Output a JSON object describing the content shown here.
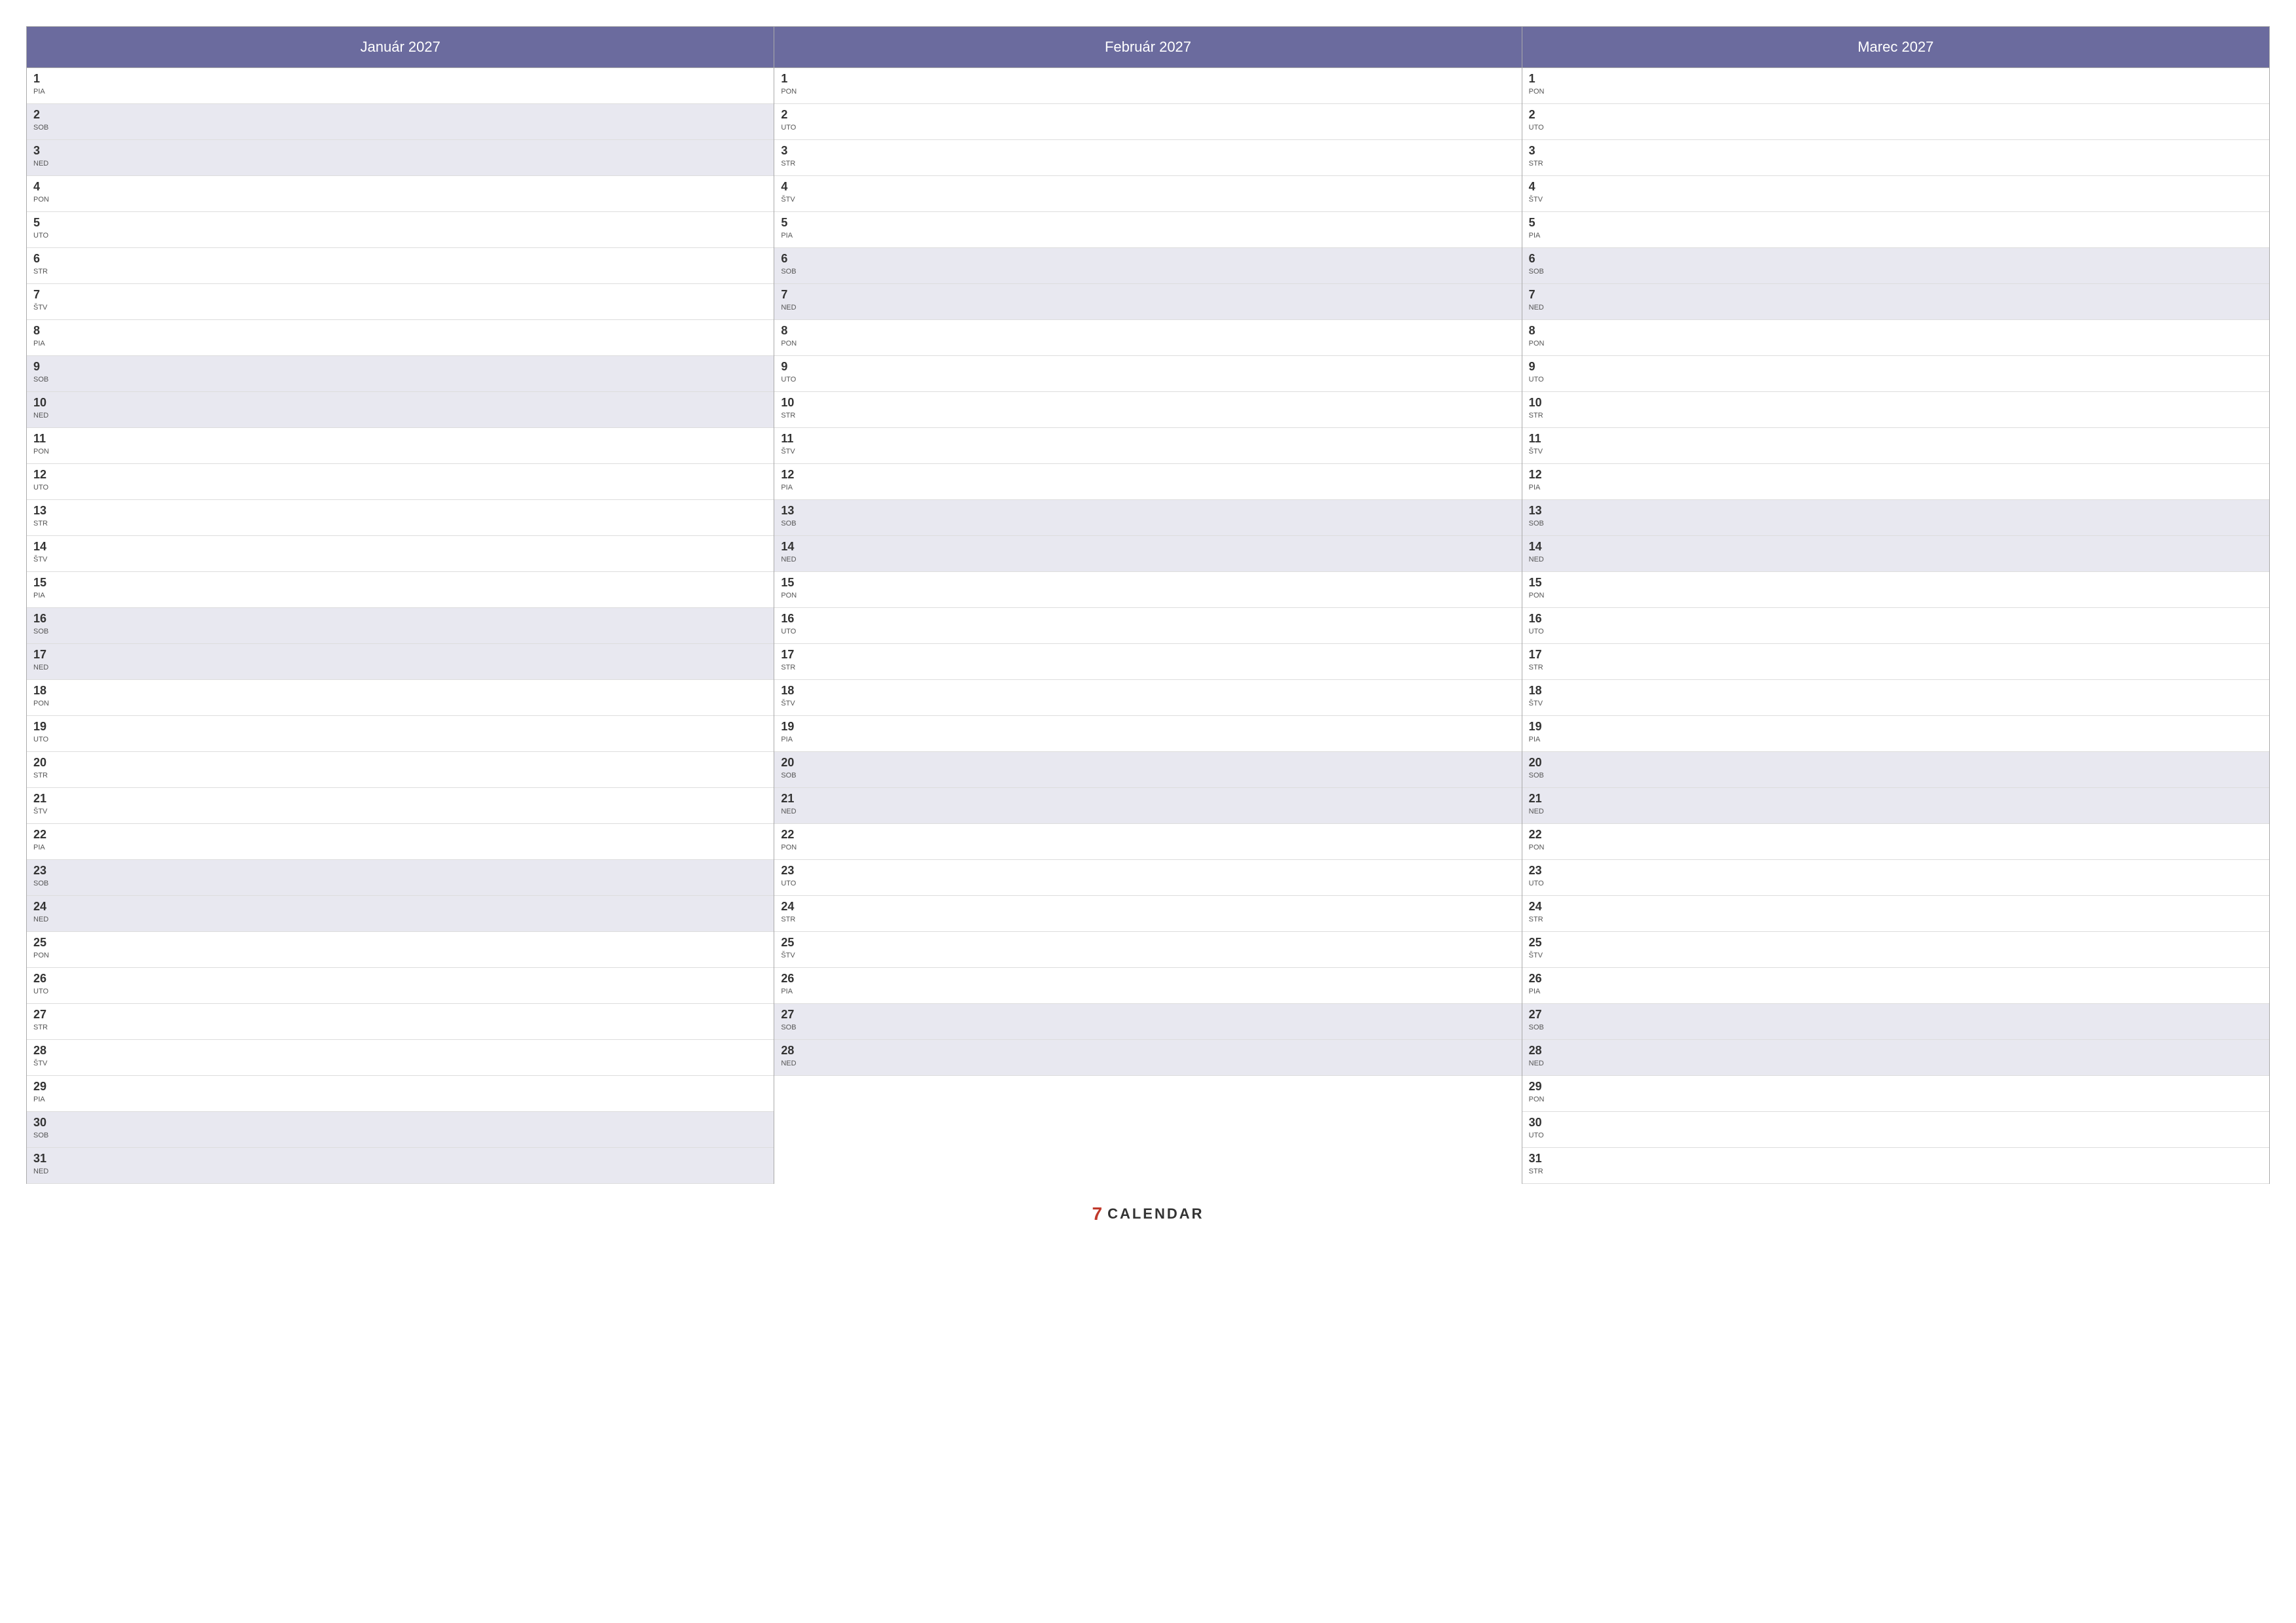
{
  "months": [
    {
      "title": "Január 2027",
      "days": [
        {
          "num": "1",
          "name": "PIA",
          "weekend": false
        },
        {
          "num": "2",
          "name": "SOB",
          "weekend": true
        },
        {
          "num": "3",
          "name": "NED",
          "weekend": true
        },
        {
          "num": "4",
          "name": "PON",
          "weekend": false
        },
        {
          "num": "5",
          "name": "UTO",
          "weekend": false
        },
        {
          "num": "6",
          "name": "STR",
          "weekend": false
        },
        {
          "num": "7",
          "name": "ŠTV",
          "weekend": false
        },
        {
          "num": "8",
          "name": "PIA",
          "weekend": false
        },
        {
          "num": "9",
          "name": "SOB",
          "weekend": true
        },
        {
          "num": "10",
          "name": "NED",
          "weekend": true
        },
        {
          "num": "11",
          "name": "PON",
          "weekend": false
        },
        {
          "num": "12",
          "name": "UTO",
          "weekend": false
        },
        {
          "num": "13",
          "name": "STR",
          "weekend": false
        },
        {
          "num": "14",
          "name": "ŠTV",
          "weekend": false
        },
        {
          "num": "15",
          "name": "PIA",
          "weekend": false
        },
        {
          "num": "16",
          "name": "SOB",
          "weekend": true
        },
        {
          "num": "17",
          "name": "NED",
          "weekend": true
        },
        {
          "num": "18",
          "name": "PON",
          "weekend": false
        },
        {
          "num": "19",
          "name": "UTO",
          "weekend": false
        },
        {
          "num": "20",
          "name": "STR",
          "weekend": false
        },
        {
          "num": "21",
          "name": "ŠTV",
          "weekend": false
        },
        {
          "num": "22",
          "name": "PIA",
          "weekend": false
        },
        {
          "num": "23",
          "name": "SOB",
          "weekend": true
        },
        {
          "num": "24",
          "name": "NED",
          "weekend": true
        },
        {
          "num": "25",
          "name": "PON",
          "weekend": false
        },
        {
          "num": "26",
          "name": "UTO",
          "weekend": false
        },
        {
          "num": "27",
          "name": "STR",
          "weekend": false
        },
        {
          "num": "28",
          "name": "ŠTV",
          "weekend": false
        },
        {
          "num": "29",
          "name": "PIA",
          "weekend": false
        },
        {
          "num": "30",
          "name": "SOB",
          "weekend": true
        },
        {
          "num": "31",
          "name": "NED",
          "weekend": true
        }
      ]
    },
    {
      "title": "Február 2027",
      "days": [
        {
          "num": "1",
          "name": "PON",
          "weekend": false
        },
        {
          "num": "2",
          "name": "UTO",
          "weekend": false
        },
        {
          "num": "3",
          "name": "STR",
          "weekend": false
        },
        {
          "num": "4",
          "name": "ŠTV",
          "weekend": false
        },
        {
          "num": "5",
          "name": "PIA",
          "weekend": false
        },
        {
          "num": "6",
          "name": "SOB",
          "weekend": true
        },
        {
          "num": "7",
          "name": "NED",
          "weekend": true
        },
        {
          "num": "8",
          "name": "PON",
          "weekend": false
        },
        {
          "num": "9",
          "name": "UTO",
          "weekend": false
        },
        {
          "num": "10",
          "name": "STR",
          "weekend": false
        },
        {
          "num": "11",
          "name": "ŠTV",
          "weekend": false
        },
        {
          "num": "12",
          "name": "PIA",
          "weekend": false
        },
        {
          "num": "13",
          "name": "SOB",
          "weekend": true
        },
        {
          "num": "14",
          "name": "NED",
          "weekend": true
        },
        {
          "num": "15",
          "name": "PON",
          "weekend": false
        },
        {
          "num": "16",
          "name": "UTO",
          "weekend": false
        },
        {
          "num": "17",
          "name": "STR",
          "weekend": false
        },
        {
          "num": "18",
          "name": "ŠTV",
          "weekend": false
        },
        {
          "num": "19",
          "name": "PIA",
          "weekend": false
        },
        {
          "num": "20",
          "name": "SOB",
          "weekend": true
        },
        {
          "num": "21",
          "name": "NED",
          "weekend": true
        },
        {
          "num": "22",
          "name": "PON",
          "weekend": false
        },
        {
          "num": "23",
          "name": "UTO",
          "weekend": false
        },
        {
          "num": "24",
          "name": "STR",
          "weekend": false
        },
        {
          "num": "25",
          "name": "ŠTV",
          "weekend": false
        },
        {
          "num": "26",
          "name": "PIA",
          "weekend": false
        },
        {
          "num": "27",
          "name": "SOB",
          "weekend": true
        },
        {
          "num": "28",
          "name": "NED",
          "weekend": true
        }
      ]
    },
    {
      "title": "Marec 2027",
      "days": [
        {
          "num": "1",
          "name": "PON",
          "weekend": false
        },
        {
          "num": "2",
          "name": "UTO",
          "weekend": false
        },
        {
          "num": "3",
          "name": "STR",
          "weekend": false
        },
        {
          "num": "4",
          "name": "ŠTV",
          "weekend": false
        },
        {
          "num": "5",
          "name": "PIA",
          "weekend": false
        },
        {
          "num": "6",
          "name": "SOB",
          "weekend": true
        },
        {
          "num": "7",
          "name": "NED",
          "weekend": true
        },
        {
          "num": "8",
          "name": "PON",
          "weekend": false
        },
        {
          "num": "9",
          "name": "UTO",
          "weekend": false
        },
        {
          "num": "10",
          "name": "STR",
          "weekend": false
        },
        {
          "num": "11",
          "name": "ŠTV",
          "weekend": false
        },
        {
          "num": "12",
          "name": "PIA",
          "weekend": false
        },
        {
          "num": "13",
          "name": "SOB",
          "weekend": true
        },
        {
          "num": "14",
          "name": "NED",
          "weekend": true
        },
        {
          "num": "15",
          "name": "PON",
          "weekend": false
        },
        {
          "num": "16",
          "name": "UTO",
          "weekend": false
        },
        {
          "num": "17",
          "name": "STR",
          "weekend": false
        },
        {
          "num": "18",
          "name": "ŠTV",
          "weekend": false
        },
        {
          "num": "19",
          "name": "PIA",
          "weekend": false
        },
        {
          "num": "20",
          "name": "SOB",
          "weekend": true
        },
        {
          "num": "21",
          "name": "NED",
          "weekend": true
        },
        {
          "num": "22",
          "name": "PON",
          "weekend": false
        },
        {
          "num": "23",
          "name": "UTO",
          "weekend": false
        },
        {
          "num": "24",
          "name": "STR",
          "weekend": false
        },
        {
          "num": "25",
          "name": "ŠTV",
          "weekend": false
        },
        {
          "num": "26",
          "name": "PIA",
          "weekend": false
        },
        {
          "num": "27",
          "name": "SOB",
          "weekend": true
        },
        {
          "num": "28",
          "name": "NED",
          "weekend": true
        },
        {
          "num": "29",
          "name": "PON",
          "weekend": false
        },
        {
          "num": "30",
          "name": "UTO",
          "weekend": false
        },
        {
          "num": "31",
          "name": "STR",
          "weekend": false
        }
      ]
    }
  ],
  "brand": {
    "icon": "7",
    "text": "CALENDAR"
  }
}
